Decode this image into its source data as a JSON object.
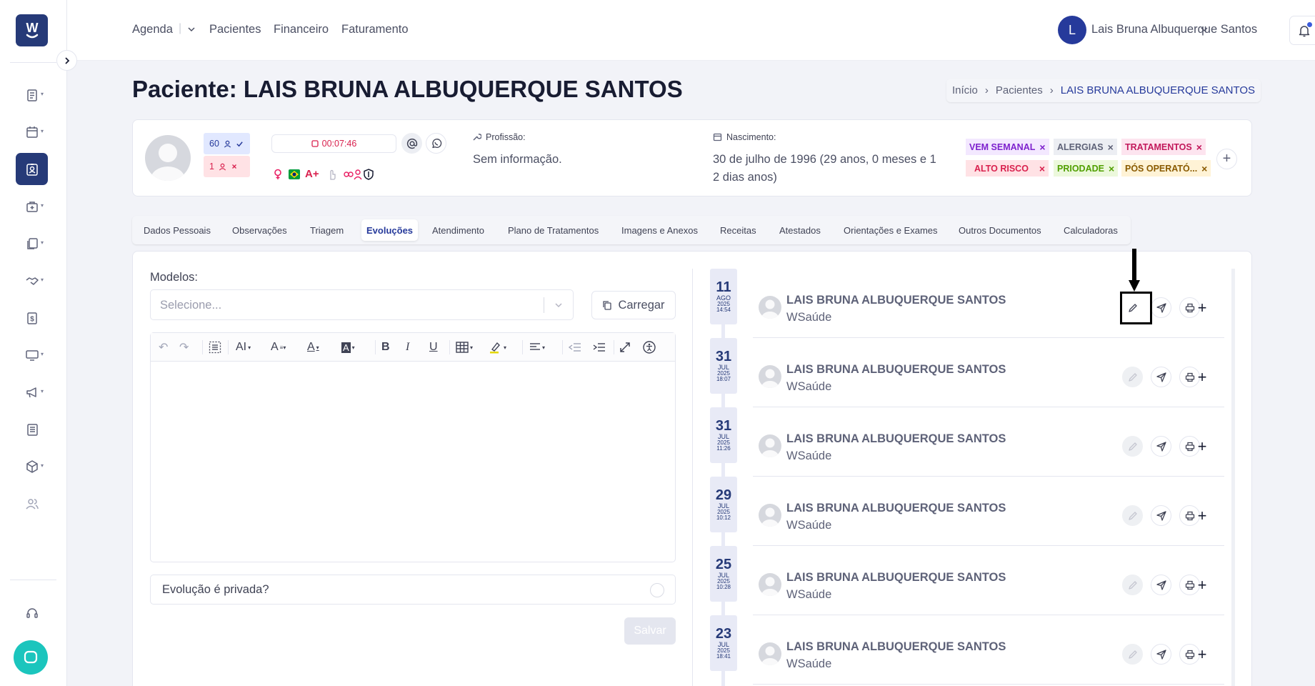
{
  "sidebar": {
    "logo_letter": "W",
    "items": [
      {
        "icon": "document-list-icon"
      },
      {
        "icon": "calendar-icon"
      },
      {
        "icon": "patient-card-icon",
        "active": true
      },
      {
        "icon": "medical-kit-icon"
      },
      {
        "icon": "documents-icon"
      },
      {
        "icon": "handshake-icon"
      },
      {
        "icon": "dollar-icon"
      },
      {
        "icon": "monitor-icon"
      },
      {
        "icon": "megaphone-icon"
      },
      {
        "icon": "newspaper-icon"
      },
      {
        "icon": "box-icon"
      },
      {
        "icon": "users-icon"
      }
    ],
    "support_icon": "headset-icon",
    "chat_icon": "chat-icon"
  },
  "header": {
    "nav": [
      "Agenda",
      "Pacientes",
      "Financeiro",
      "Faturamento"
    ],
    "user_initial": "L",
    "user_name": "Lais Bruna Albuquerque Santos"
  },
  "page": {
    "title": "Paciente: LAIS BRUNA ALBUQUERQUE SANTOS",
    "breadcrumb": [
      "Início",
      "Pacientes",
      "LAIS BRUNA ALBUQUERQUE SANTOS"
    ]
  },
  "patient": {
    "badge_count_1": "60",
    "badge_count_2": "1",
    "timer": "00:07:46",
    "blood_type": "A+",
    "profession_label": "Profissão:",
    "profession_value": "Sem informação.",
    "birth_label": "Nascimento:",
    "birth_value_line1": "30 de julho de 1996 (29 anos, 0 meses e 1",
    "birth_value_line2": "2 dias anos)",
    "tags": [
      {
        "label": "VEM SEMANAL",
        "color": "#7e22ce",
        "bg": "#f3e8ff"
      },
      {
        "label": "ALERGIAS",
        "color": "#5e6278",
        "bg": "#eceef3"
      },
      {
        "label": "TRATAMENTOS",
        "color": "#c2185b",
        "bg": "#fde4ef"
      },
      {
        "label": "ALTO RISCO",
        "color": "#d9214e",
        "bg": "#ffe2e5"
      },
      {
        "label": "PRIODADE",
        "color": "#50a000",
        "bg": "#ecf8dc"
      },
      {
        "label": "PÓS OPERATÓ...",
        "color": "#8a5a00",
        "bg": "#fff3d6"
      }
    ]
  },
  "tabs": [
    "Dados Pessoais",
    "Observações",
    "Triagem",
    "Evoluções",
    "Atendimento",
    "Plano de Tratamentos",
    "Imagens e Anexos",
    "Receitas",
    "Atestados",
    "Orientações e Exames",
    "Outros Documentos",
    "Calculadoras"
  ],
  "active_tab": "Evoluções",
  "form": {
    "models_label": "Modelos:",
    "select_placeholder": "Selecione...",
    "load_button": "Carregar",
    "private_label": "Evolução é privada?",
    "save_button": "Salvar"
  },
  "evolutions": [
    {
      "day": "11",
      "month": "AGO",
      "year": "2025",
      "time": "14:54",
      "name": "LAIS BRUNA ALBUQUERQUE SANTOS",
      "org": "WSaúde"
    },
    {
      "day": "31",
      "month": "JUL",
      "year": "2025",
      "time": "18:07",
      "name": "LAIS BRUNA ALBUQUERQUE SANTOS",
      "org": "WSaúde"
    },
    {
      "day": "31",
      "month": "JUL",
      "year": "2025",
      "time": "11:26",
      "name": "LAIS BRUNA ALBUQUERQUE SANTOS",
      "org": "WSaúde"
    },
    {
      "day": "29",
      "month": "JUL",
      "year": "2025",
      "time": "10:12",
      "name": "LAIS BRUNA ALBUQUERQUE SANTOS",
      "org": "WSaúde"
    },
    {
      "day": "25",
      "month": "JUL",
      "year": "2025",
      "time": "10:28",
      "name": "LAIS BRUNA ALBUQUERQUE SANTOS",
      "org": "WSaúde"
    },
    {
      "day": "23",
      "month": "JUL",
      "year": "2025",
      "time": "18:41",
      "name": "LAIS BRUNA ALBUQUERQUE SANTOS",
      "org": "WSaúde"
    }
  ],
  "colors": {
    "brand": "#263a78",
    "accent": "#263a9b",
    "danger": "#d9214e",
    "teal": "#1bc5bd"
  }
}
